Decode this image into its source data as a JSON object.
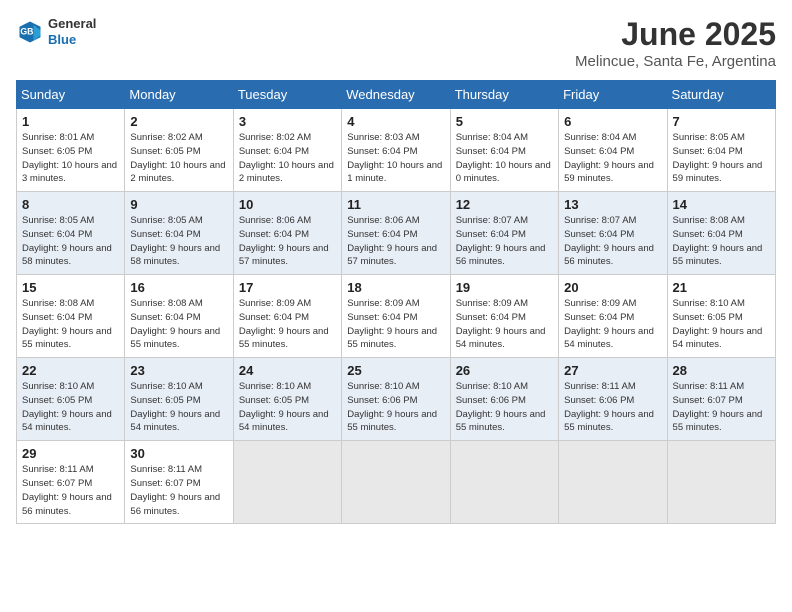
{
  "header": {
    "logo_general": "General",
    "logo_blue": "Blue",
    "month_year": "June 2025",
    "location": "Melincue, Santa Fe, Argentina"
  },
  "weekdays": [
    "Sunday",
    "Monday",
    "Tuesday",
    "Wednesday",
    "Thursday",
    "Friday",
    "Saturday"
  ],
  "weeks": [
    [
      {
        "day": "1",
        "sunrise": "Sunrise: 8:01 AM",
        "sunset": "Sunset: 6:05 PM",
        "daylight": "Daylight: 10 hours and 3 minutes."
      },
      {
        "day": "2",
        "sunrise": "Sunrise: 8:02 AM",
        "sunset": "Sunset: 6:05 PM",
        "daylight": "Daylight: 10 hours and 2 minutes."
      },
      {
        "day": "3",
        "sunrise": "Sunrise: 8:02 AM",
        "sunset": "Sunset: 6:04 PM",
        "daylight": "Daylight: 10 hours and 2 minutes."
      },
      {
        "day": "4",
        "sunrise": "Sunrise: 8:03 AM",
        "sunset": "Sunset: 6:04 PM",
        "daylight": "Daylight: 10 hours and 1 minute."
      },
      {
        "day": "5",
        "sunrise": "Sunrise: 8:04 AM",
        "sunset": "Sunset: 6:04 PM",
        "daylight": "Daylight: 10 hours and 0 minutes."
      },
      {
        "day": "6",
        "sunrise": "Sunrise: 8:04 AM",
        "sunset": "Sunset: 6:04 PM",
        "daylight": "Daylight: 9 hours and 59 minutes."
      },
      {
        "day": "7",
        "sunrise": "Sunrise: 8:05 AM",
        "sunset": "Sunset: 6:04 PM",
        "daylight": "Daylight: 9 hours and 59 minutes."
      }
    ],
    [
      {
        "day": "8",
        "sunrise": "Sunrise: 8:05 AM",
        "sunset": "Sunset: 6:04 PM",
        "daylight": "Daylight: 9 hours and 58 minutes."
      },
      {
        "day": "9",
        "sunrise": "Sunrise: 8:05 AM",
        "sunset": "Sunset: 6:04 PM",
        "daylight": "Daylight: 9 hours and 58 minutes."
      },
      {
        "day": "10",
        "sunrise": "Sunrise: 8:06 AM",
        "sunset": "Sunset: 6:04 PM",
        "daylight": "Daylight: 9 hours and 57 minutes."
      },
      {
        "day": "11",
        "sunrise": "Sunrise: 8:06 AM",
        "sunset": "Sunset: 6:04 PM",
        "daylight": "Daylight: 9 hours and 57 minutes."
      },
      {
        "day": "12",
        "sunrise": "Sunrise: 8:07 AM",
        "sunset": "Sunset: 6:04 PM",
        "daylight": "Daylight: 9 hours and 56 minutes."
      },
      {
        "day": "13",
        "sunrise": "Sunrise: 8:07 AM",
        "sunset": "Sunset: 6:04 PM",
        "daylight": "Daylight: 9 hours and 56 minutes."
      },
      {
        "day": "14",
        "sunrise": "Sunrise: 8:08 AM",
        "sunset": "Sunset: 6:04 PM",
        "daylight": "Daylight: 9 hours and 55 minutes."
      }
    ],
    [
      {
        "day": "15",
        "sunrise": "Sunrise: 8:08 AM",
        "sunset": "Sunset: 6:04 PM",
        "daylight": "Daylight: 9 hours and 55 minutes."
      },
      {
        "day": "16",
        "sunrise": "Sunrise: 8:08 AM",
        "sunset": "Sunset: 6:04 PM",
        "daylight": "Daylight: 9 hours and 55 minutes."
      },
      {
        "day": "17",
        "sunrise": "Sunrise: 8:09 AM",
        "sunset": "Sunset: 6:04 PM",
        "daylight": "Daylight: 9 hours and 55 minutes."
      },
      {
        "day": "18",
        "sunrise": "Sunrise: 8:09 AM",
        "sunset": "Sunset: 6:04 PM",
        "daylight": "Daylight: 9 hours and 55 minutes."
      },
      {
        "day": "19",
        "sunrise": "Sunrise: 8:09 AM",
        "sunset": "Sunset: 6:04 PM",
        "daylight": "Daylight: 9 hours and 54 minutes."
      },
      {
        "day": "20",
        "sunrise": "Sunrise: 8:09 AM",
        "sunset": "Sunset: 6:04 PM",
        "daylight": "Daylight: 9 hours and 54 minutes."
      },
      {
        "day": "21",
        "sunrise": "Sunrise: 8:10 AM",
        "sunset": "Sunset: 6:05 PM",
        "daylight": "Daylight: 9 hours and 54 minutes."
      }
    ],
    [
      {
        "day": "22",
        "sunrise": "Sunrise: 8:10 AM",
        "sunset": "Sunset: 6:05 PM",
        "daylight": "Daylight: 9 hours and 54 minutes."
      },
      {
        "day": "23",
        "sunrise": "Sunrise: 8:10 AM",
        "sunset": "Sunset: 6:05 PM",
        "daylight": "Daylight: 9 hours and 54 minutes."
      },
      {
        "day": "24",
        "sunrise": "Sunrise: 8:10 AM",
        "sunset": "Sunset: 6:05 PM",
        "daylight": "Daylight: 9 hours and 54 minutes."
      },
      {
        "day": "25",
        "sunrise": "Sunrise: 8:10 AM",
        "sunset": "Sunset: 6:06 PM",
        "daylight": "Daylight: 9 hours and 55 minutes."
      },
      {
        "day": "26",
        "sunrise": "Sunrise: 8:10 AM",
        "sunset": "Sunset: 6:06 PM",
        "daylight": "Daylight: 9 hours and 55 minutes."
      },
      {
        "day": "27",
        "sunrise": "Sunrise: 8:11 AM",
        "sunset": "Sunset: 6:06 PM",
        "daylight": "Daylight: 9 hours and 55 minutes."
      },
      {
        "day": "28",
        "sunrise": "Sunrise: 8:11 AM",
        "sunset": "Sunset: 6:07 PM",
        "daylight": "Daylight: 9 hours and 55 minutes."
      }
    ],
    [
      {
        "day": "29",
        "sunrise": "Sunrise: 8:11 AM",
        "sunset": "Sunset: 6:07 PM",
        "daylight": "Daylight: 9 hours and 56 minutes."
      },
      {
        "day": "30",
        "sunrise": "Sunrise: 8:11 AM",
        "sunset": "Sunset: 6:07 PM",
        "daylight": "Daylight: 9 hours and 56 minutes."
      },
      {
        "day": "",
        "sunrise": "",
        "sunset": "",
        "daylight": ""
      },
      {
        "day": "",
        "sunrise": "",
        "sunset": "",
        "daylight": ""
      },
      {
        "day": "",
        "sunrise": "",
        "sunset": "",
        "daylight": ""
      },
      {
        "day": "",
        "sunrise": "",
        "sunset": "",
        "daylight": ""
      },
      {
        "day": "",
        "sunrise": "",
        "sunset": "",
        "daylight": ""
      }
    ]
  ]
}
